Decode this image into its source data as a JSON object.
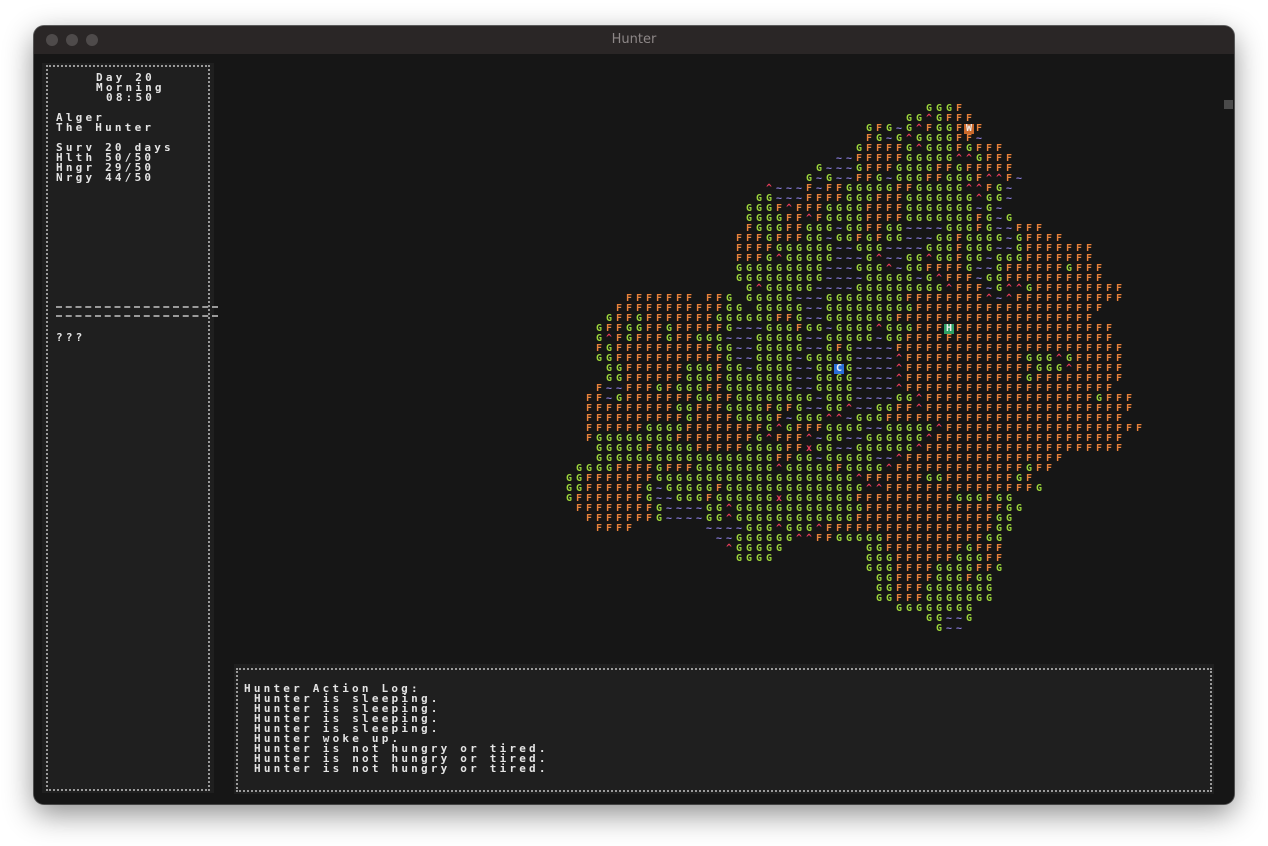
{
  "window": {
    "title": "Hunter"
  },
  "sidebar": {
    "day": "Day 20",
    "period": "Morning",
    "time": "08:50",
    "name": "Alger",
    "role": "The Hunter",
    "survival": "Surv 20 days",
    "health": "Hlth 50/50",
    "hunger": "Hngr 29/50",
    "energy": "Nrgy 44/50",
    "lower_text": "???"
  },
  "log": {
    "heading": "Hunter Action Log:",
    "entries": [
      "Hunter is sleeping.",
      "Hunter is sleeping.",
      "Hunter is sleeping.",
      "Hunter is sleeping.",
      "Hunter woke up.",
      "Hunter is not hungry or tired.",
      "Hunter is not hungry or tired.",
      "Hunter is not hungry or tired."
    ]
  },
  "map": {
    "legend": {
      "G": "grass",
      "F": "forest",
      "~": "water",
      "^": "mountain",
      "H": "hunter",
      "C": "camp",
      "W": "wolf",
      "x": "carcass"
    },
    "colors": {
      "G": "#9bd63a",
      "F": "#e8823a",
      "~": "#8a7fe0",
      "^": "#e83d5b",
      "x": "#e83d5b",
      "H_bg": "#2fa065",
      "C_bg": "#2a6ed8",
      "W_bg": "#c9692c",
      "marker_fg": "#f0f0f0"
    },
    "rows": [
      "                                          GGGF",
      "                                        GG^GFFF",
      "                                    GFG~G^FGGFWF",
      "                                    FG~G^GGGGFF~",
      "                                   GFFFFG^GGGFGFFF",
      "                                 ~~FFFFFGGGGG^^GFFF",
      "                               G~~~GFFFGGGGFFGFFFFF",
      "                              G~G~~FFG~GGGFFGGGF^^F~",
      "                          ^~~~F~FFGGGGGFFGGGGG^^FG~",
      "                         GG~~~FFFFGGGFFFGGGGGGG^GG~",
      "                        GGGF^FFFGGGGFFFFGGGGGGG~G~",
      "                        GGGGFF^FGGGGFFFFGGGGGGGFG~G",
      "                        FGGGFFGGG~GGFFGG~~~~GGGFG~~FFF",
      "                       FFFGFFFGG~GGFGFGG~~~GGFGGGG~GFFFF",
      "                       FFFFGGGGGG~~GGG~~~~GGGFGGG~~GFFFFFFF",
      "                       FFFG^GGGGG~~~G^~~GG^GGFGG~GGGFFFFFFF",
      "                       GGGGGGGGG~~~GGG^~GGFFFFG~~GFFFFFFGFFF",
      "                       GGGGGGGGG~~~~GGGGG~G^FFF~GGFFFFFFFFFF",
      "                        G^GGGGG~~~~GGGGGGGGG^FFF~G^^GFFFFFFFFF",
      "            FFFFFFF FFG GGGGG~~~GGGGGGGGFFFFFFFF^~^FFFFFFFFFFF",
      "           FFFFFFFFFFFGG GGGGG~~GGGGGGGGGFFFFFFFFFFFFFFFFFFF",
      "          GFFGFFFFFFFGGGGGGFFG~~GGGGGGGFFFFFFFFFFFFFFFFFFFF",
      "         GFFGGFFGFFFFFG~~~GGGFGG~GGGG^GGGFFFHFFFFFFFFFFFFFFFF",
      "         G^FGFFFGFFGGG~~~GGGGG~~GGGGG~GGFFFFFFFFFFFFFFFFFFFFF",
      "         FGFFFFFFFFFFGG~~GGGGG~~GFG~~~~FFFFFFFFFFFFFFFFFFFFFFF",
      "         GGFFFFFFFFFFFG~~GGGG~GGGGG~~~~^FFFFFFFFFFFFGGG^GFFFFF",
      "          GGFFFFFFGGGFGG~GGGG~~GGCG~~~~^FFFFFFFFFFFFFGGG^FFFFF",
      "          GGFFFFFFGGGFGGGGGGG~~GGGG~~~~^FFFFFFFFFFFFGFFFFFFFFF",
      "         F~~FFFGFGGGFFGGGGGGG~~GGGG~~~~^FFFFFFFFFFFFFFFFFFFFF",
      "        FF~GFFFFFFFGGFFGGGGGGGG~GGG~~~~GG^FFFFFFFFFFFFFFFFFGFFF",
      "        FFFFFFFFFGGFFFGGGGFGFG~~GG^~~GGFF^FFFFFFFFFFFFFFFFFFFFF",
      "        FFFFFFFFFFGFFFFGGGGF~GGG^^~GGGFFFFFFFFFFFFFFFFFFFFFFFF",
      "        FFFFFFGGGGFFFFFFFFG^GFFFGGGG~~GGGGG^FFFFFFFFFFFFFFFFFFFF",
      "        FGGGGGGGGFFFFFFFFG^FFF^~GG~~GGGGGG^FFFFFFFFFFFFFFFFFFF",
      "         GGGGGFGGGGFFFFFGGGGFFxGG~~GGGGGG^FFFFFFFFFFFFFFFFFFFF",
      "         GGGGGGGGGGGGGGGGGGFFGG~GGGGG~~^FFFFFFFFFFFFFFFF",
      "       GGGGFFFFGFFFGGGGGGGG^GGGGGFGGGG^FFFFFFFFFFFFFGFF",
      "      GGFFFFFFFGGGGGGGGGGGGGGGGGGGG^FFFFFFGGFFFFFFFGF",
      "      GGFFFFFFG~GGGGGFGGGGGGGGGGGGGG^^FFFFFFFFFFFFFFFG",
      "      GFFFFFFFG~~GGGFGGGGGGxGGGGGGGFFFFFFFFFFGGGFGG",
      "       FFFFFFFFG~~~~GG^GGGGGGGGGGGGGFFFFFFFFFFFFFFGG",
      "        FFFFFFFG~~~~GG^GGGGGGGGGGGGFFFFFFFFFFFFFFGG",
      "         FFFF       ~~~~GGG^GGG^FFFFFFFFFFFFFFFFFGG",
      "                     ~~GGGGGG^^FFGGGGGFFFFFFFFFFGG",
      "                      ^GGGGG        GGFFFFFFFFGFFF",
      "                       GGGG         GGGFFFFFFGGGFF",
      "                                    GGGFFFFGGGGFFG",
      "                                     GGFFFFGGGFGG",
      "                                     GGFFFGGGGGGG",
      "                                     GGFFFGGGGGGG",
      "                                       GGGGGGGG",
      "                                          GG~~G",
      "                                           G~~"
    ]
  }
}
